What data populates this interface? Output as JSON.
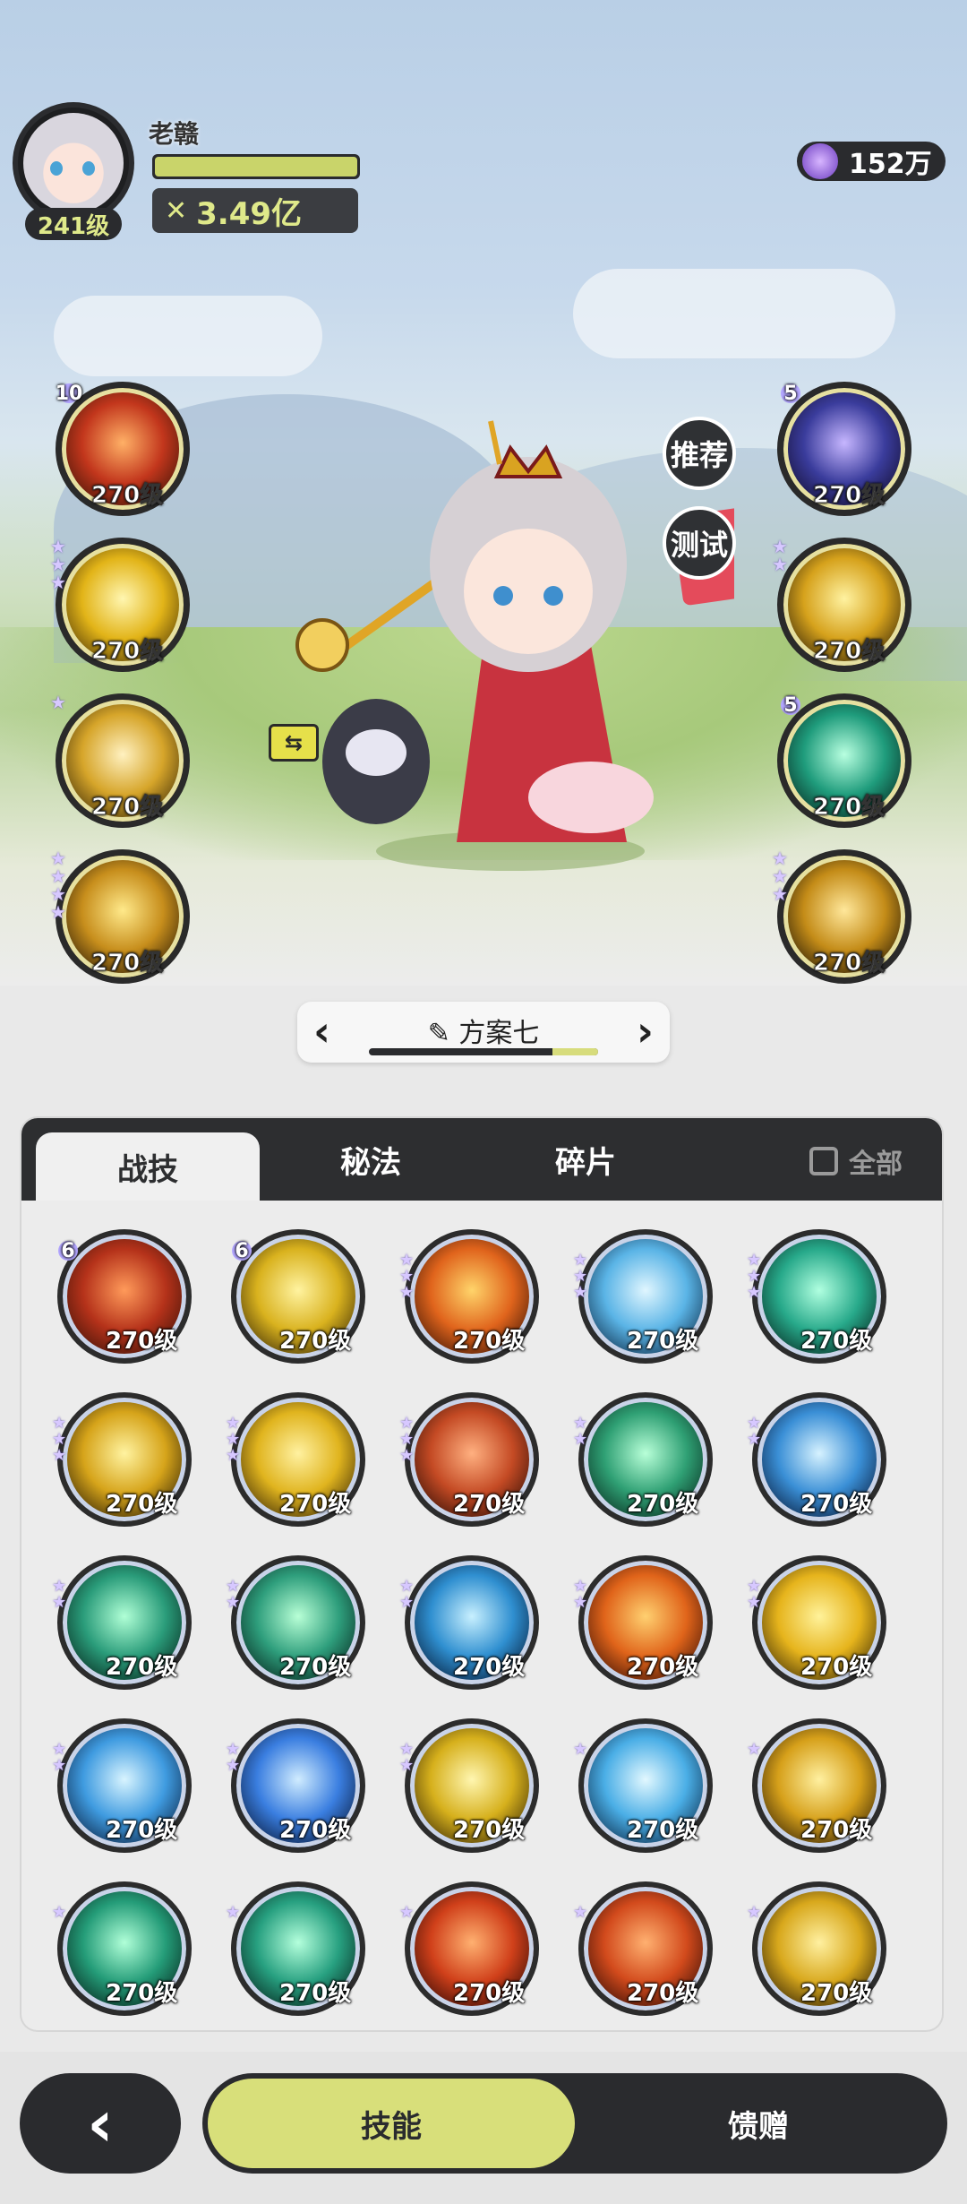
{
  "player": {
    "name": "老赣",
    "level": "241级",
    "power": "3.49亿",
    "xp_fraction": 1.0
  },
  "currency": {
    "value": "152万",
    "icon": "gem-icon"
  },
  "hero_buttons": {
    "recommend": "推荐",
    "test": "测试",
    "pet_swap": "⇆"
  },
  "left_slots": [
    {
      "level": "270级",
      "badge": "10",
      "stars": 0,
      "colors": [
        "#ffb066",
        "#c2361c",
        "#3a1408"
      ]
    },
    {
      "level": "270级",
      "badge": "",
      "stars": 3,
      "colors": [
        "#fff6b0",
        "#e2b418",
        "#4a3408"
      ]
    },
    {
      "level": "270级",
      "badge": "",
      "stars": 1,
      "colors": [
        "#fff1c0",
        "#d6a52a",
        "#3e2c08"
      ]
    },
    {
      "level": "270级",
      "badge": "",
      "stars": 4,
      "colors": [
        "#ffe98a",
        "#c78e1c",
        "#2a1a06"
      ]
    }
  ],
  "right_slots": [
    {
      "level": "270级",
      "badge": "5",
      "stars": 0,
      "colors": [
        "#c6b6ff",
        "#3a3c9c",
        "#120c2a"
      ]
    },
    {
      "level": "270级",
      "badge": "",
      "stars": 2,
      "colors": [
        "#fff2a0",
        "#d6a21c",
        "#2e2008"
      ]
    },
    {
      "level": "270级",
      "badge": "5",
      "stars": 0,
      "colors": [
        "#b8ffe0",
        "#1f9c7c",
        "#08261e"
      ]
    },
    {
      "level": "270级",
      "badge": "",
      "stars": 3,
      "colors": [
        "#ffe79a",
        "#c48c18",
        "#1e1406"
      ]
    }
  ],
  "scheme": {
    "label": "方案七",
    "edit_icon": "pencil-icon",
    "prev": "‹",
    "next": "›",
    "progress": 0.2
  },
  "tabs": [
    {
      "label": "战技",
      "active": true
    },
    {
      "label": "秘法",
      "active": false
    },
    {
      "label": "碎片",
      "active": false
    }
  ],
  "filter": {
    "label": "全部",
    "checked": false
  },
  "skills": [
    {
      "level": "270级",
      "badge": "6",
      "stars": 0,
      "colors": [
        "#ff9a5a",
        "#b5321a",
        "#3a1208"
      ]
    },
    {
      "level": "270级",
      "badge": "6",
      "stars": 0,
      "colors": [
        "#fff3a0",
        "#d9b21e",
        "#3a2a06"
      ]
    },
    {
      "level": "270级",
      "badge": "",
      "stars": 3,
      "colors": [
        "#ffd46a",
        "#e0641c",
        "#3a1406"
      ]
    },
    {
      "level": "270级",
      "badge": "",
      "stars": 3,
      "colors": [
        "#e0f6ff",
        "#5ab4e6",
        "#0c2a46"
      ]
    },
    {
      "level": "270级",
      "badge": "",
      "stars": 3,
      "colors": [
        "#b0ffe0",
        "#27a98a",
        "#06261e"
      ]
    },
    {
      "level": "270级",
      "badge": "",
      "stars": 3,
      "colors": [
        "#fff3a0",
        "#d6a41a",
        "#2e2006"
      ]
    },
    {
      "level": "270级",
      "badge": "",
      "stars": 3,
      "colors": [
        "#fff1a0",
        "#e0b41e",
        "#3a2806"
      ]
    },
    {
      "level": "270级",
      "badge": "",
      "stars": 3,
      "colors": [
        "#ffb080",
        "#c44a24",
        "#2e0e06"
      ]
    },
    {
      "level": "270级",
      "badge": "",
      "stars": 2,
      "colors": [
        "#b8ffd8",
        "#2fa074",
        "#082a1e"
      ]
    },
    {
      "level": "270级",
      "badge": "",
      "stars": 2,
      "colors": [
        "#d6f2ff",
        "#3a8fd6",
        "#081a3a"
      ]
    },
    {
      "level": "270级",
      "badge": "",
      "stars": 2,
      "colors": [
        "#b0ffd6",
        "#2a9c7a",
        "#06241a"
      ]
    },
    {
      "level": "270级",
      "badge": "",
      "stars": 2,
      "colors": [
        "#b8ffd6",
        "#2e9e7c",
        "#06241c"
      ]
    },
    {
      "level": "270级",
      "badge": "",
      "stars": 2,
      "colors": [
        "#c8f0ff",
        "#2f8fd0",
        "#061a36"
      ]
    },
    {
      "level": "270级",
      "badge": "",
      "stars": 2,
      "colors": [
        "#ffd070",
        "#e0641a",
        "#3a1006"
      ]
    },
    {
      "level": "270级",
      "badge": "",
      "stars": 2,
      "colors": [
        "#fff29a",
        "#e6b41c",
        "#3a2a06"
      ]
    },
    {
      "level": "270级",
      "badge": "",
      "stars": 2,
      "colors": [
        "#d8f4ff",
        "#3f9be0",
        "#0a2040"
      ]
    },
    {
      "level": "270级",
      "badge": "",
      "stars": 2,
      "colors": [
        "#d0ecff",
        "#3a7ee0",
        "#081838"
      ]
    },
    {
      "level": "270级",
      "badge": "",
      "stars": 2,
      "colors": [
        "#fff6b0",
        "#d6b01c",
        "#3a2a06"
      ]
    },
    {
      "level": "270级",
      "badge": "",
      "stars": 1,
      "colors": [
        "#e2f8ff",
        "#4aaee6",
        "#0a2846"
      ]
    },
    {
      "level": "270级",
      "badge": "",
      "stars": 1,
      "colors": [
        "#fff0a0",
        "#d6a01a",
        "#2e1e06"
      ]
    },
    {
      "level": "270级",
      "badge": "",
      "stars": 1,
      "colors": [
        "#b0ffd8",
        "#249c78",
        "#06221a"
      ]
    },
    {
      "level": "270级",
      "badge": "",
      "stars": 1,
      "colors": [
        "#b4ffdc",
        "#27a080",
        "#06241c"
      ]
    },
    {
      "level": "270级",
      "badge": "",
      "stars": 1,
      "colors": [
        "#ffb070",
        "#d0401a",
        "#2e0a06"
      ]
    },
    {
      "level": "270级",
      "badge": "",
      "stars": 1,
      "colors": [
        "#ffb070",
        "#d24a1c",
        "#300c06"
      ]
    },
    {
      "level": "270级",
      "badge": "",
      "stars": 1,
      "colors": [
        "#fff0a0",
        "#d8a81c",
        "#2a1c06"
      ]
    }
  ],
  "bottom_nav": {
    "back": "‹",
    "skill": "技能",
    "gift": "馈赠"
  }
}
